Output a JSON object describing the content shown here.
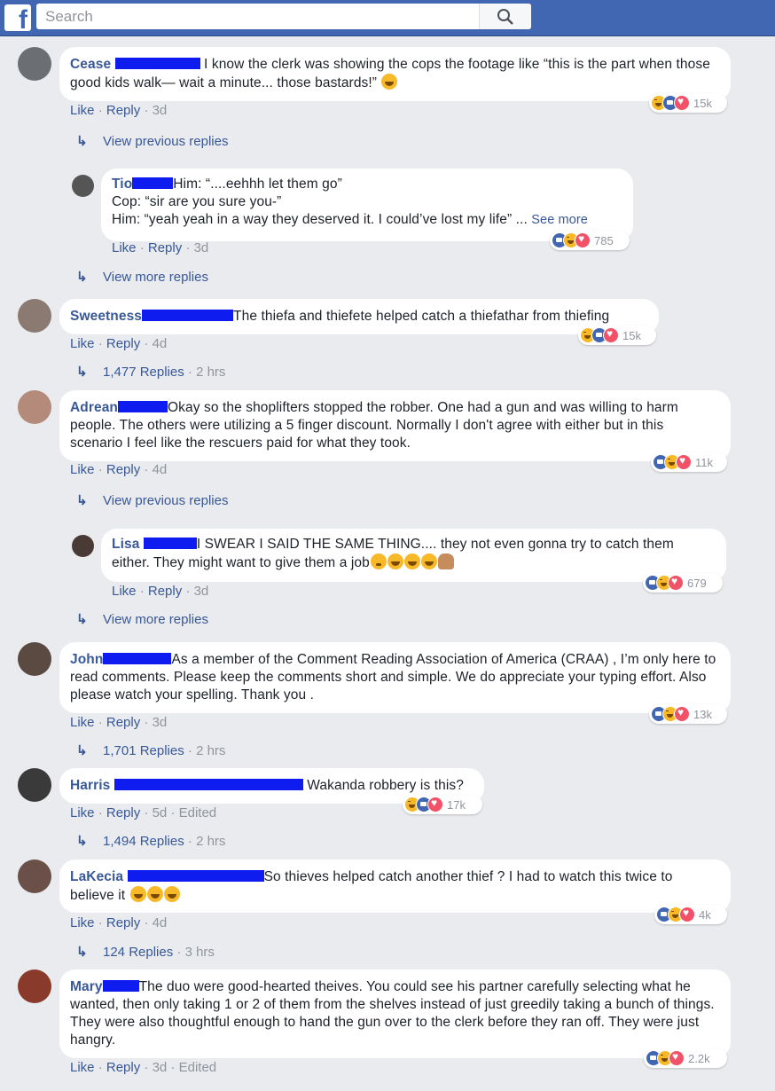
{
  "brand": {
    "logo_letter": "f",
    "color": "#4267b2"
  },
  "search": {
    "placeholder": "Search",
    "icon": "search-icon"
  },
  "labels": {
    "like": "Like",
    "reply": "Reply",
    "sep": "·",
    "see_more": "See more"
  },
  "colors": {
    "redaction": "#0f1cf0",
    "link": "#385898",
    "meta": "#90949c"
  },
  "comments": [
    {
      "name": "Cease",
      "text": "I know the clerk was showing the cops the footage like “this is the part when those good kids walk— wait a minute... those bastards!”",
      "emoji": "😂",
      "age": "3d",
      "reactions": "15k",
      "subtext": "View previous replies"
    },
    {
      "name": "Tio",
      "line1": "Him: “....eehhh let them go”",
      "line2": "Cop: “sir are you sure you-”",
      "line3": "Him: “yeah yeah in a way they deserved it. I could’ve lost my life” ...",
      "age": "3d",
      "reactions": "785",
      "subtext": "View more replies"
    },
    {
      "name": "Sweetness",
      "text": "The thiefa and thiefete helped catch a thiefathar from thiefing",
      "age": "4d",
      "reactions": "15k",
      "replies": "1,477 Replies",
      "replies_age": "2 hrs"
    },
    {
      "name": "Adrean",
      "text": "Okay so the shoplifters stopped the robber. One had a gun and was willing to harm people. The others were utilizing a 5 finger discount. Normally I don't agree with either but in this scenario I feel like the rescuers paid for what they took.",
      "age": "4d",
      "reactions": "11k",
      "subtext": "View previous replies"
    },
    {
      "name": "Lisa",
      "text": "I SWEAR I SAID THE SAME THING.... they not even gonna try to catch them either. They might want to give them a job",
      "emoji": "😳😂😂😂🤷",
      "age": "3d",
      "reactions": "679",
      "subtext": "View more replies"
    },
    {
      "name": "John",
      "text": "As a member of the Comment Reading Association of America (CRAA) , I’m only here to read comments. Please keep the comments short and simple. We do appreciate your typing effort. Also please watch your spelling. Thank you .",
      "age": "3d",
      "reactions": "13k",
      "replies": "1,701 Replies",
      "replies_age": "2 hrs"
    },
    {
      "name": "Harris",
      "text": "Wakanda robbery is this?",
      "age": "5d",
      "edited": "Edited",
      "reactions": "17k",
      "replies": "1,494 Replies",
      "replies_age": "2 hrs"
    },
    {
      "name": "LaKecia",
      "text": "So thieves helped catch another thief ? I had to watch this twice to believe it",
      "emoji": "😂😂😂",
      "age": "4d",
      "reactions": "4k",
      "replies": "124 Replies",
      "replies_age": "3 hrs"
    },
    {
      "name": "Mary",
      "text": "The duo were good-hearted theives. You could see his partner carefully selecting what he wanted, then only taking 1 or 2 of them from the shelves instead of just greedily taking a bunch of things. They were also thoughtful enough to hand the gun over to the clerk before they ran off. They were just hangry.",
      "age": "3d",
      "edited": "Edited",
      "reactions": "2.2k"
    }
  ]
}
